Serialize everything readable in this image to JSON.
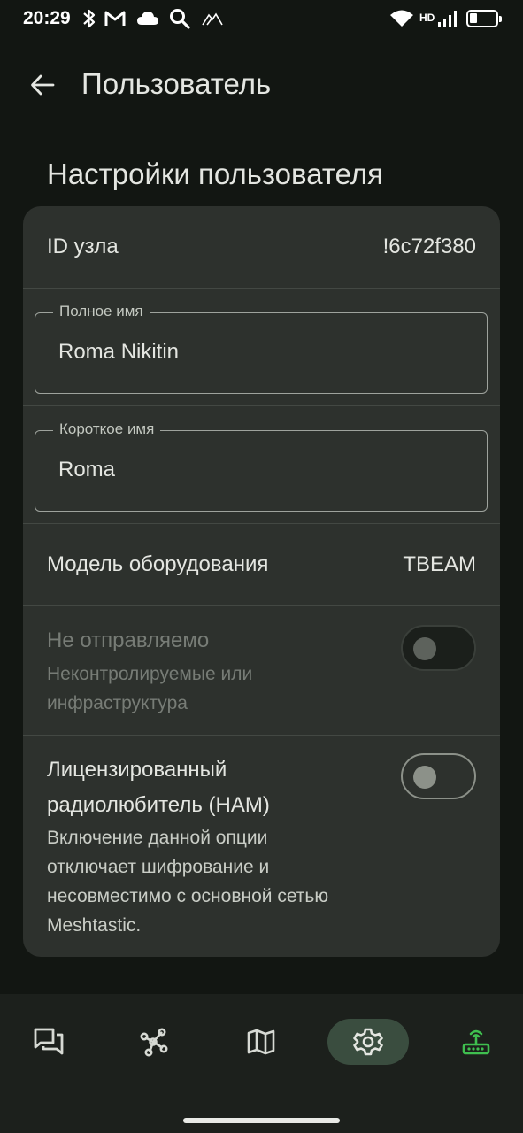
{
  "status_bar": {
    "time": "20:29",
    "network_type": "HD",
    "icons": [
      "bluetooth-icon",
      "gmail-icon",
      "cloud-icon",
      "search-icon",
      "signal-shape-icon",
      "wifi-icon",
      "cell-signal-icon",
      "battery-icon"
    ]
  },
  "app_bar": {
    "title": "Пользователь"
  },
  "section": {
    "title": "Настройки пользователя"
  },
  "node_id": {
    "label": "ID узла",
    "value": "!6c72f380"
  },
  "long_name": {
    "label": "Полное имя",
    "value": "Roma Nikitin"
  },
  "short_name": {
    "label": "Короткое имя",
    "value": "Roma"
  },
  "hardware": {
    "label": "Модель оборудования",
    "value": "TBEAM"
  },
  "unmessageable": {
    "title": "Не отправляемо",
    "description_line1": "Неконтролируемые или",
    "description_line2": "инфраструктура",
    "enabled": false,
    "disabled": true
  },
  "licensed_ham": {
    "title_line1": "Лицензированный",
    "title_line2": "радиолюбитель (HAM)",
    "description_line1": "Включение данной опции",
    "description_line2": "отключает шифрование и",
    "description_line3": "несовместимо с основной сетью",
    "description_line4": "Meshtastic.",
    "enabled": false
  },
  "bottom_nav": {
    "items": [
      {
        "icon": "messages-icon",
        "active": false
      },
      {
        "icon": "nodes-icon",
        "active": false
      },
      {
        "icon": "map-icon",
        "active": false
      },
      {
        "icon": "settings-icon",
        "active": true
      },
      {
        "icon": "connection-router-icon",
        "active": false,
        "color": "#3fbf4f"
      }
    ]
  },
  "colors": {
    "background": "#121612",
    "card": "#2d312d",
    "nav_background": "#1c201c",
    "nav_active": "#3a4d3f",
    "connected_green": "#3fbf4f"
  }
}
